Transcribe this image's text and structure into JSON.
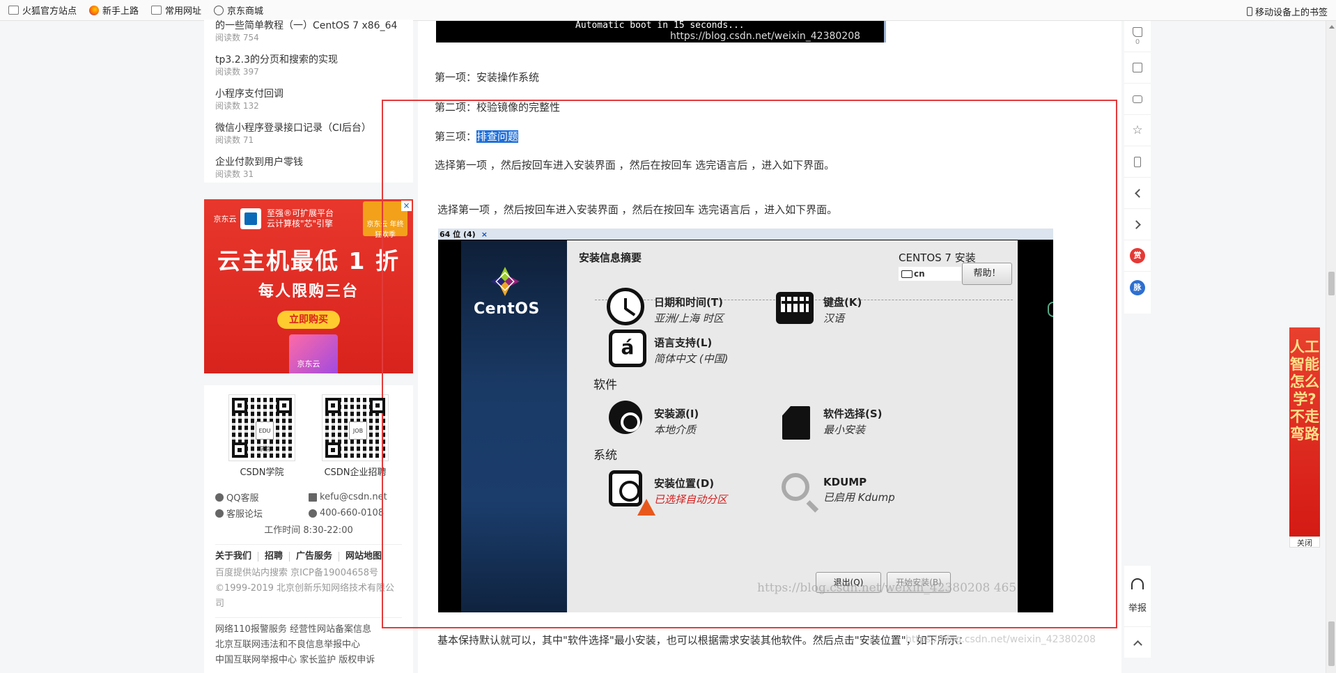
{
  "bookmarks": {
    "items": [
      {
        "label": "火狐官方站点",
        "icon": "folder-icon"
      },
      {
        "label": "新手上路",
        "icon": "firefox-icon"
      },
      {
        "label": "常用网址",
        "icon": "folder-icon"
      },
      {
        "label": "京东商城",
        "icon": "globe-icon"
      }
    ],
    "mobile": "移动设备上的书签"
  },
  "sidebar": {
    "articles": [
      {
        "title": "的一些简单教程（一）CentOS 7 x86_64",
        "reads": "阅读数 754"
      },
      {
        "title": "tp3.2.3的分页和搜索的实现",
        "reads": "阅读数 397"
      },
      {
        "title": "小程序支付回调",
        "reads": "阅读数 132"
      },
      {
        "title": "微信小程序登录接口记录（CI后台）",
        "reads": "阅读数 71"
      },
      {
        "title": "企业付款到用户零钱",
        "reads": "阅读数 31"
      }
    ],
    "ad": {
      "brand": "京东云",
      "sub1": "至强®可扩展平台",
      "sub2": "云计算核\"芯\"引擎",
      "corner": "京东云 年终 狂欢季",
      "main": "云主机最低 1 折",
      "line2": "每人限购三台",
      "button": "立即购买",
      "footer": "京东云",
      "close": "×"
    },
    "qr": [
      {
        "label": "CSDN学院",
        "mark": "EDU 学院"
      },
      {
        "label": "CSDN企业招聘",
        "mark": "JOB"
      }
    ],
    "contact": {
      "qq": "QQ客服",
      "email": "kefu@csdn.net",
      "forum": "客服论坛",
      "phone": "400-660-0108",
      "hours": "工作时间 8:30-22:00"
    },
    "links": [
      "关于我们",
      "招聘",
      "广告服务",
      "网站地图"
    ],
    "legal": {
      "line1": "百度提供站内搜索 京ICP备19004658号",
      "line2": "©1999-2019 北京创新乐知网络技术有限公司"
    },
    "legal2": {
      "line1": "网络110报警服务   经营性网站备案信息",
      "line2": "北京互联网违法和不良信息举报中心",
      "line3": "中国互联网举报中心 家长监护 版权申诉"
    }
  },
  "article": {
    "code_text": "Automatic boot in 15 seconds...",
    "code_watermark": "https://blog.csdn.net/weixin_42380208",
    "p1": "第一项：安装操作系统",
    "p2": "第二项：校验镜像的完整性",
    "p3_prefix": "第三项：",
    "p3_highlight": "排查问题",
    "p4": "选择第一项 ，然后按回车进入安装界面 ，然后在按回车 选完语言后 ，进入如下界面。",
    "p5": "选择第一项 ，然后按回车进入安装界面 ，然后在按回车  选完语言后 ，进入如下界面。",
    "p6": "基本保持默认就可以，其中\"软件选择\"最小安装，也可以根据需求安装其他软件。然后点击\"安装位置\"，如下所示：",
    "p6_watermark": "https://blog.csdn.net/weixin_42380208"
  },
  "installer": {
    "tab": "64 位 (4)",
    "tab_close": "×",
    "brand": "CentOS",
    "title": "安装信息摘要",
    "os": "CENTOS 7 安装",
    "keyboard": "cn",
    "help": "帮助！",
    "localization_items": [
      {
        "name": "日期和时间(T)",
        "sub": "亚洲/上海 时区"
      },
      {
        "name": "键盘(K)",
        "sub": "汉语"
      },
      {
        "name": "语言支持(L)",
        "sub": "简体中文 (中国)"
      }
    ],
    "cat_software": "软件",
    "software_items": [
      {
        "name": "安装源(I)",
        "sub": "本地介质"
      },
      {
        "name": "软件选择(S)",
        "sub": "最小安装"
      }
    ],
    "cat_system": "系统",
    "system_items": [
      {
        "name": "安装位置(D)",
        "sub": "已选择自动分区"
      },
      {
        "name": "KDUMP",
        "sub": "已启用 Kdump"
      }
    ],
    "lang_glyph": "á",
    "quit": "退出(Q)",
    "start": "开始安装(B)",
    "watermark": "https://blog.csdn.net/weixin_42380208 465"
  },
  "toolbar": {
    "like_count": "0",
    "reward": "赏",
    "pulse": "脉",
    "report": "举报"
  },
  "side_ad": {
    "text": "人工智能怎么学?不走弯路",
    "close": "关闭"
  },
  "colors": {
    "highlight": "#1e6fd9",
    "annotation_box": "#e43a3a",
    "error_text": "#d31f1f",
    "reward": "#e53935",
    "pulse": "#2e6fd0"
  }
}
